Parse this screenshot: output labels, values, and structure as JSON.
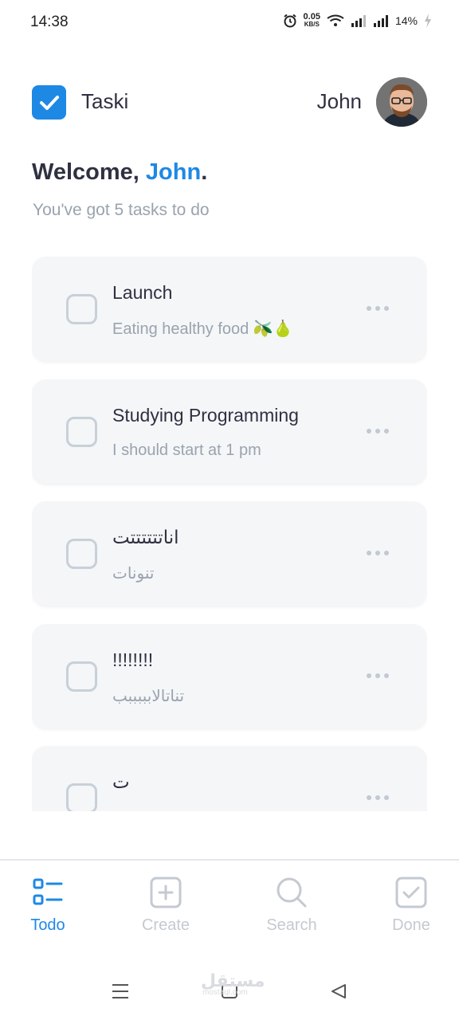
{
  "status_bar": {
    "time": "14:38",
    "net_speed": "0.05",
    "net_unit": "KB/S",
    "battery": "14%"
  },
  "header": {
    "app_name": "Taski",
    "user_name": "John",
    "brand_color": "#1e88e5"
  },
  "welcome": {
    "greeting": "Welcome,",
    "name": "John",
    "suffix": ".",
    "subtitle": "You've got 5 tasks to do"
  },
  "tasks": [
    {
      "title": "Launch",
      "description": "Eating healthy food 🫒🍐",
      "done": false
    },
    {
      "title": "Studying Programming",
      "description": "I should start at 1 pm",
      "done": false
    },
    {
      "title": "اناتتتتتتت",
      "description": "تنونات",
      "done": false
    },
    {
      "title": "!!!!!!!!",
      "description": "تناتالابببببب",
      "done": false
    },
    {
      "title": "ت",
      "description": "",
      "done": false
    }
  ],
  "bottom_nav": [
    {
      "label": "Todo",
      "icon": "todo-list-icon",
      "active": true
    },
    {
      "label": "Create",
      "icon": "plus-square-icon",
      "active": false
    },
    {
      "label": "Search",
      "icon": "search-icon",
      "active": false
    },
    {
      "label": "Done",
      "icon": "check-square-icon",
      "active": false
    }
  ],
  "system_nav": {
    "watermark": "مستقل",
    "watermark_sub": "mostaql.com"
  }
}
